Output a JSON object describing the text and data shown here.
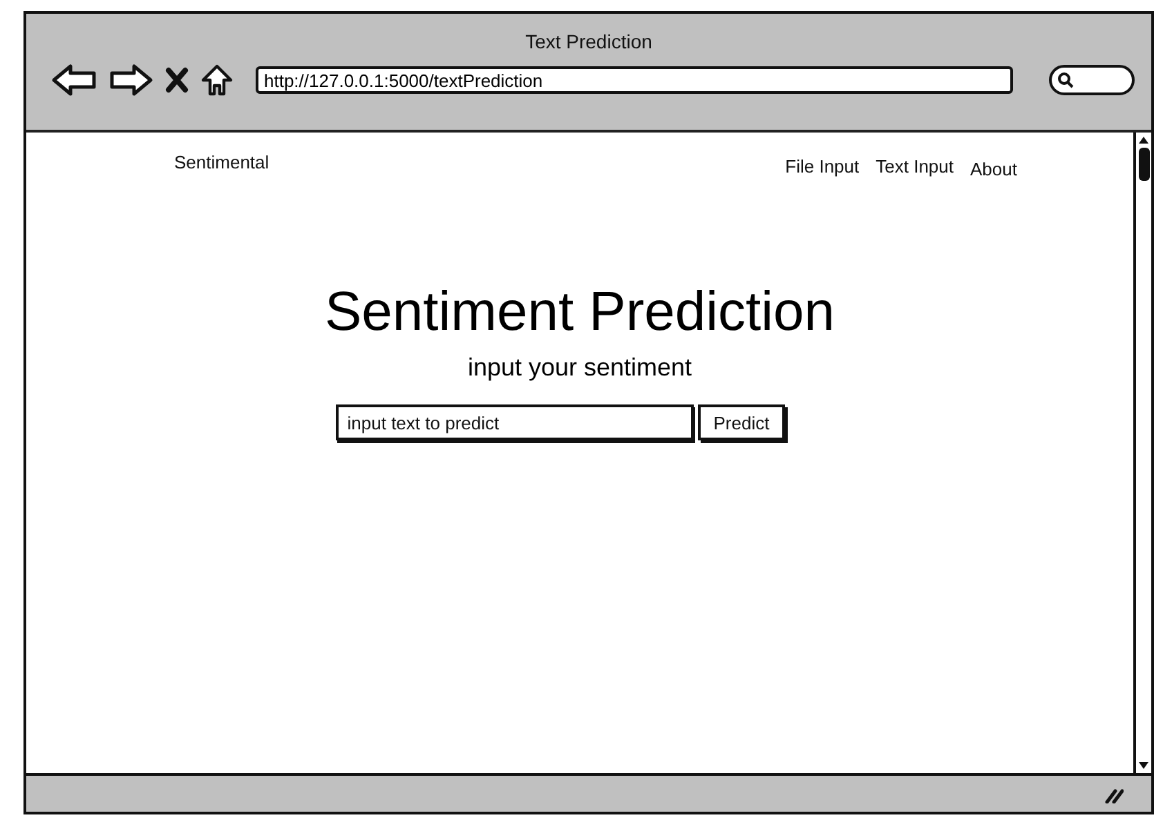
{
  "window": {
    "title": "Text Prediction"
  },
  "toolbar": {
    "url": "http://127.0.0.1:5000/textPrediction"
  },
  "navbar": {
    "brand": "Sentimental",
    "links": [
      {
        "label": "File Input"
      },
      {
        "label": "Text Input"
      },
      {
        "label": "About"
      }
    ]
  },
  "hero": {
    "title": "Sentiment Prediction",
    "subtitle": "input your sentiment"
  },
  "form": {
    "placeholder": "input text to predict",
    "button": "Predict"
  }
}
